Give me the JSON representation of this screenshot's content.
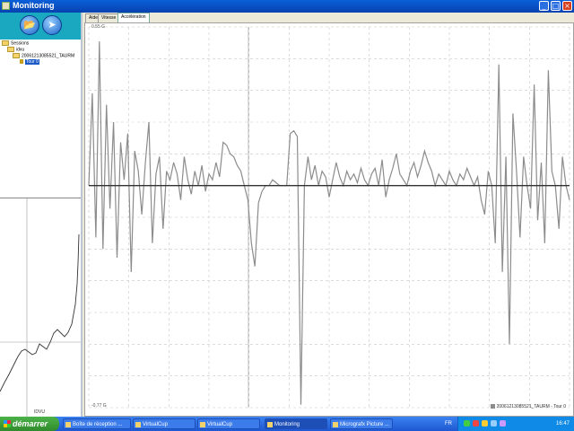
{
  "window": {
    "title": "Monitoring",
    "minimize": "_",
    "maximize": "□",
    "close": "×"
  },
  "toolbar": {
    "open_icon": "folder-open-icon",
    "forward_icon": "arrow-right-icon"
  },
  "tree": {
    "root": "Sessions",
    "user": "idvu",
    "session": "20061213085521_TAURM",
    "lap": "Tour 0"
  },
  "minigraph": {
    "xlabel": "IDVU"
  },
  "tabs": [
    "Aide",
    "Vitesse",
    "Accélération"
  ],
  "active_tab": "Accélération",
  "chart": {
    "y_top_label": "0.55 G",
    "y_bottom_label": "-0.77 G",
    "legend": "20061213085521_TAURM - Tour 0",
    "colors": {
      "line": "#8c8c8c",
      "zero": "#333333",
      "grid": "#c8c8c8"
    }
  },
  "chart_data": {
    "type": "line",
    "title": "",
    "ylim": [
      -0.77,
      0.55
    ],
    "ylabel": "",
    "grid": true,
    "legend_position": "bottom-right",
    "series": [
      {
        "name": "20061213085521_TAURM - Tour 0",
        "values": [
          0.0,
          0.32,
          -0.18,
          0.5,
          -0.22,
          0.28,
          -0.08,
          0.22,
          -0.25,
          0.15,
          0.02,
          0.18,
          -0.3,
          0.12,
          0.05,
          -0.1,
          0.08,
          0.22,
          -0.2,
          0.04,
          0.1,
          -0.15,
          0.05,
          0.02,
          0.08,
          0.04,
          -0.05,
          0.1,
          0.02,
          -0.03,
          0.05,
          0.0,
          0.07,
          -0.02,
          0.04,
          0.02,
          0.08,
          0.03,
          0.15,
          0.14,
          0.11,
          0.1,
          0.07,
          0.05,
          0.0,
          -0.05,
          -0.2,
          -0.28,
          -0.06,
          -0.02,
          0.0,
          0.0,
          0.02,
          0.01,
          0.0,
          0.0,
          0.0,
          0.18,
          0.19,
          0.17,
          -0.76,
          0.0,
          0.1,
          0.02,
          0.07,
          0.0,
          0.05,
          0.03,
          -0.04,
          0.02,
          0.08,
          0.03,
          0.0,
          0.05,
          0.02,
          0.04,
          0.01,
          0.06,
          0.02,
          0.0,
          0.04,
          0.06,
          0.0,
          0.09,
          -0.04,
          0.02,
          0.06,
          0.11,
          0.04,
          0.02,
          0.0,
          0.05,
          0.08,
          0.03,
          0.07,
          0.12,
          0.08,
          0.05,
          0.0,
          0.04,
          0.02,
          0.0,
          0.05,
          0.02,
          0.0,
          0.04,
          0.02,
          0.06,
          0.03,
          0.0,
          0.03,
          -0.05,
          -0.1,
          0.05,
          0.0,
          -0.2,
          0.42,
          -0.3,
          0.1,
          -0.55,
          0.25,
          0.05,
          -0.18,
          0.1,
          0.0,
          -0.08,
          0.35,
          -0.12,
          0.08,
          -0.2,
          0.4,
          0.05,
          0.0,
          -0.15,
          0.1,
          0.0,
          -0.05
        ]
      }
    ]
  }
}
